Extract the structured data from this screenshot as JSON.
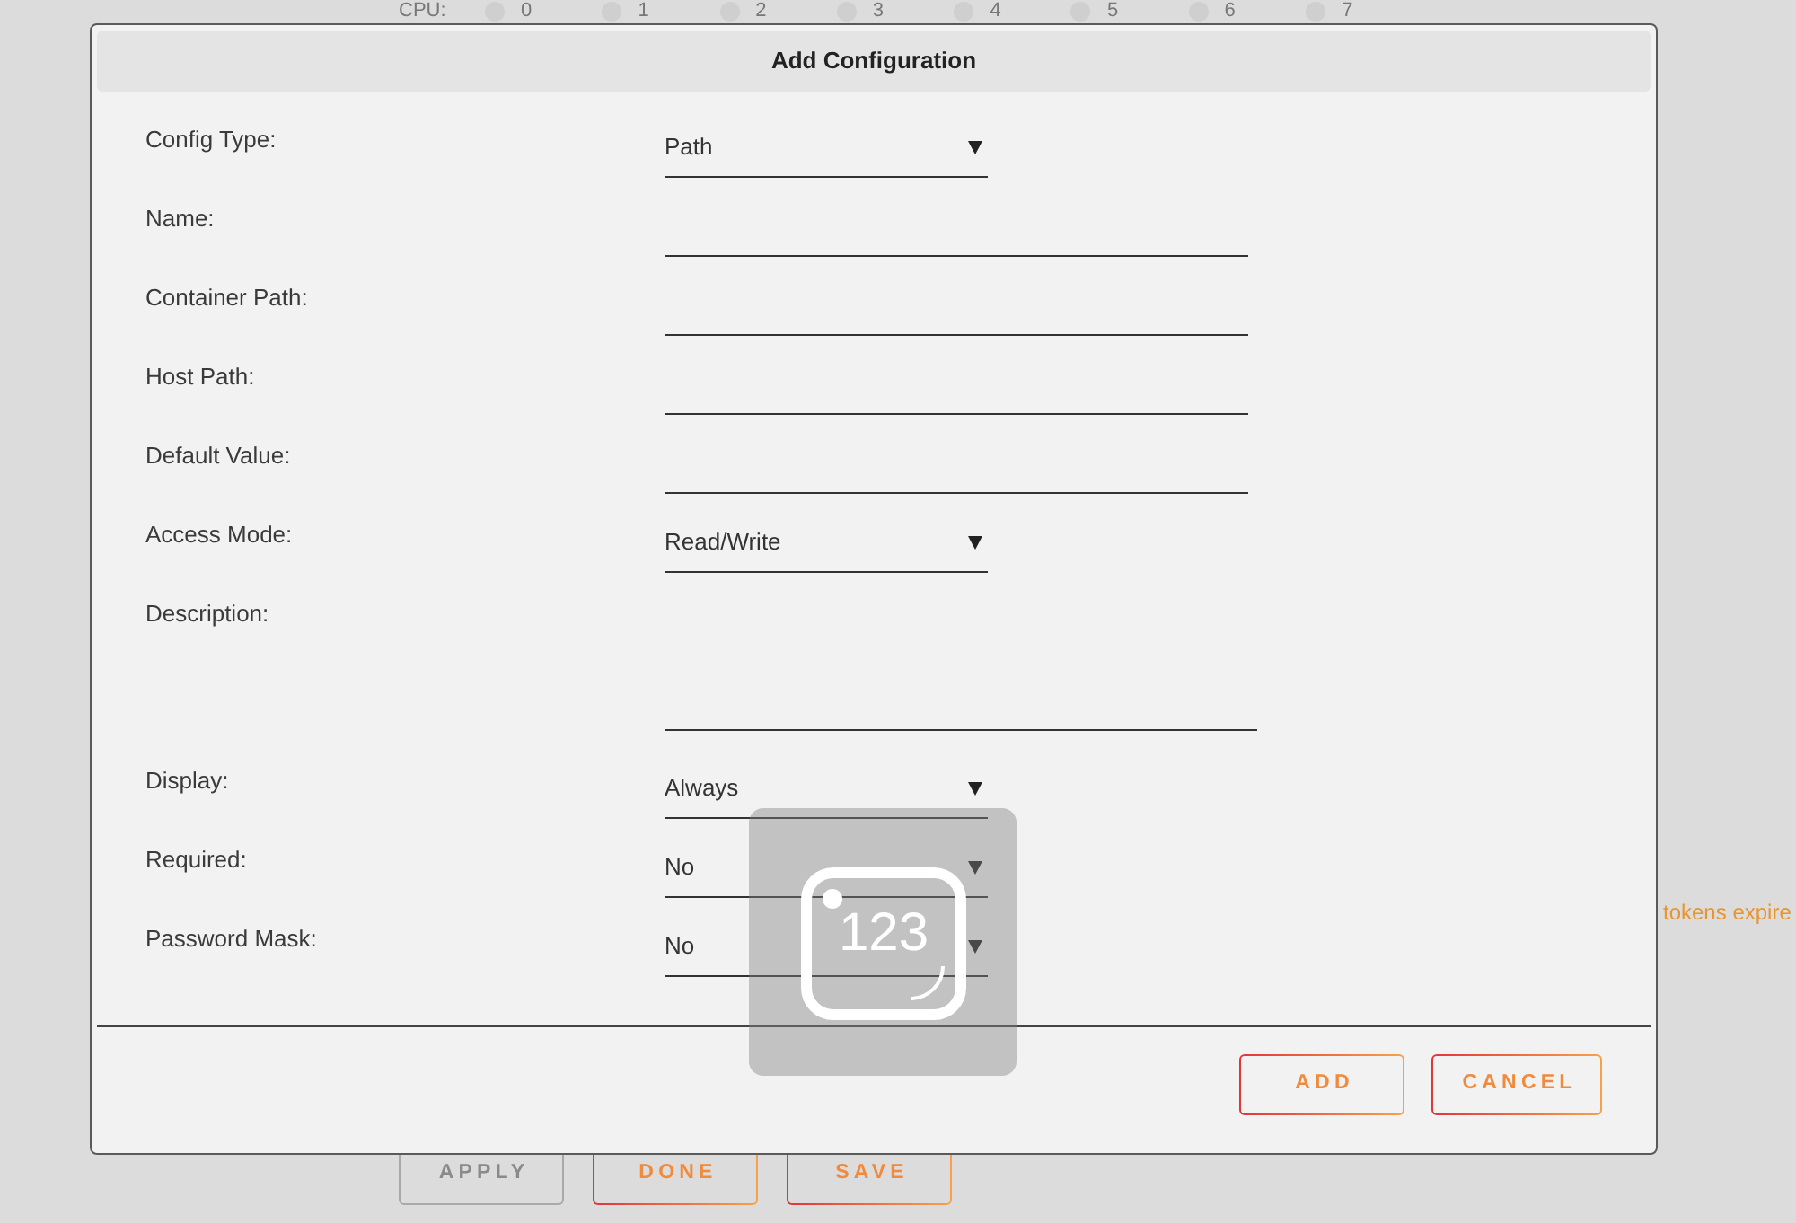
{
  "background": {
    "cpu": {
      "label": "CPU:",
      "options": [
        {
          "label": "0",
          "checked": false
        },
        {
          "label": "1",
          "checked": false
        },
        {
          "label": "2",
          "checked": false
        },
        {
          "label": "3",
          "checked": false
        },
        {
          "label": "4",
          "checked": false
        },
        {
          "label": "5",
          "checked": false
        },
        {
          "label": "6",
          "checked": false
        },
        {
          "label": "7",
          "checked": false
        }
      ]
    },
    "notice": "tokens expire",
    "buttons": [
      {
        "label": "APPLY",
        "disabled": true
      },
      {
        "label": "DONE",
        "disabled": false
      },
      {
        "label": "SAVE",
        "disabled": false
      }
    ]
  },
  "dialog": {
    "title": "Add Configuration",
    "fields": [
      {
        "label": "Config Type:",
        "kind": "select",
        "value": "Path"
      },
      {
        "label": "Name:",
        "kind": "text"
      },
      {
        "label": "Container Path:",
        "kind": "text"
      },
      {
        "label": "Host Path:",
        "kind": "text"
      },
      {
        "label": "Default Value:",
        "kind": "text"
      },
      {
        "label": "Access Mode:",
        "kind": "select",
        "value": "Read/Write"
      },
      {
        "label": "Description:",
        "kind": "textarea"
      },
      {
        "label": "Display:",
        "kind": "select",
        "value": "Always"
      },
      {
        "label": "Required:",
        "kind": "select",
        "value": "No"
      },
      {
        "label": "Password Mask:",
        "kind": "select",
        "value": "No"
      }
    ],
    "buttons": [
      {
        "label": "ADD"
      },
      {
        "label": "CANCEL"
      }
    ]
  },
  "overlay": {
    "label": "123"
  }
}
